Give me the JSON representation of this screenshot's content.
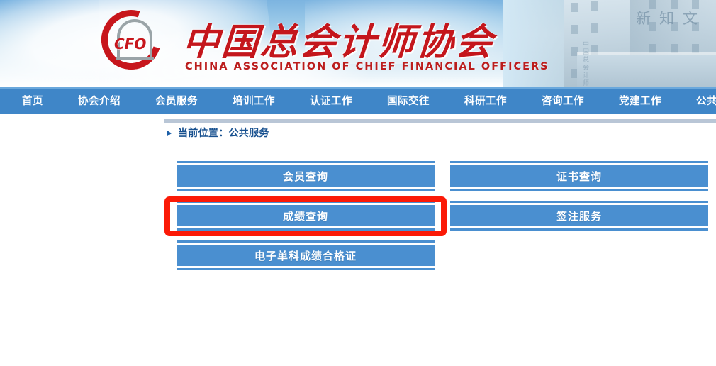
{
  "site": {
    "logo_mark": "cfo-monogram",
    "title_cn": "中国总会计师协会",
    "title_en": "CHINA ASSOCIATION OF CHIEF FINANCIAL OFFICERS"
  },
  "nav": {
    "items": [
      {
        "label": "首页"
      },
      {
        "label": "协会介绍"
      },
      {
        "label": "会员服务"
      },
      {
        "label": "培训工作"
      },
      {
        "label": "认证工作"
      },
      {
        "label": "国际交往"
      },
      {
        "label": "科研工作"
      },
      {
        "label": "咨询工作"
      },
      {
        "label": "党建工作"
      },
      {
        "label": "公共服务"
      }
    ]
  },
  "breadcrumb": {
    "text": "当前位置：公共服务"
  },
  "services": {
    "rows": [
      {
        "left": "会员查询",
        "right": "证书查询"
      },
      {
        "left": "成绩查询",
        "right": "签注服务"
      },
      {
        "left": "电子单科成绩合格证",
        "right": ""
      }
    ]
  },
  "annotation": {
    "target": "成绩查询",
    "color": "#fb1a07"
  },
  "colors": {
    "nav_blue": "#3f86c8",
    "button_blue": "#4a8fd0",
    "breadcrumb_blue": "#17508f",
    "brand_red": "#c4161c",
    "rule_grey": "#b9c6d6"
  }
}
